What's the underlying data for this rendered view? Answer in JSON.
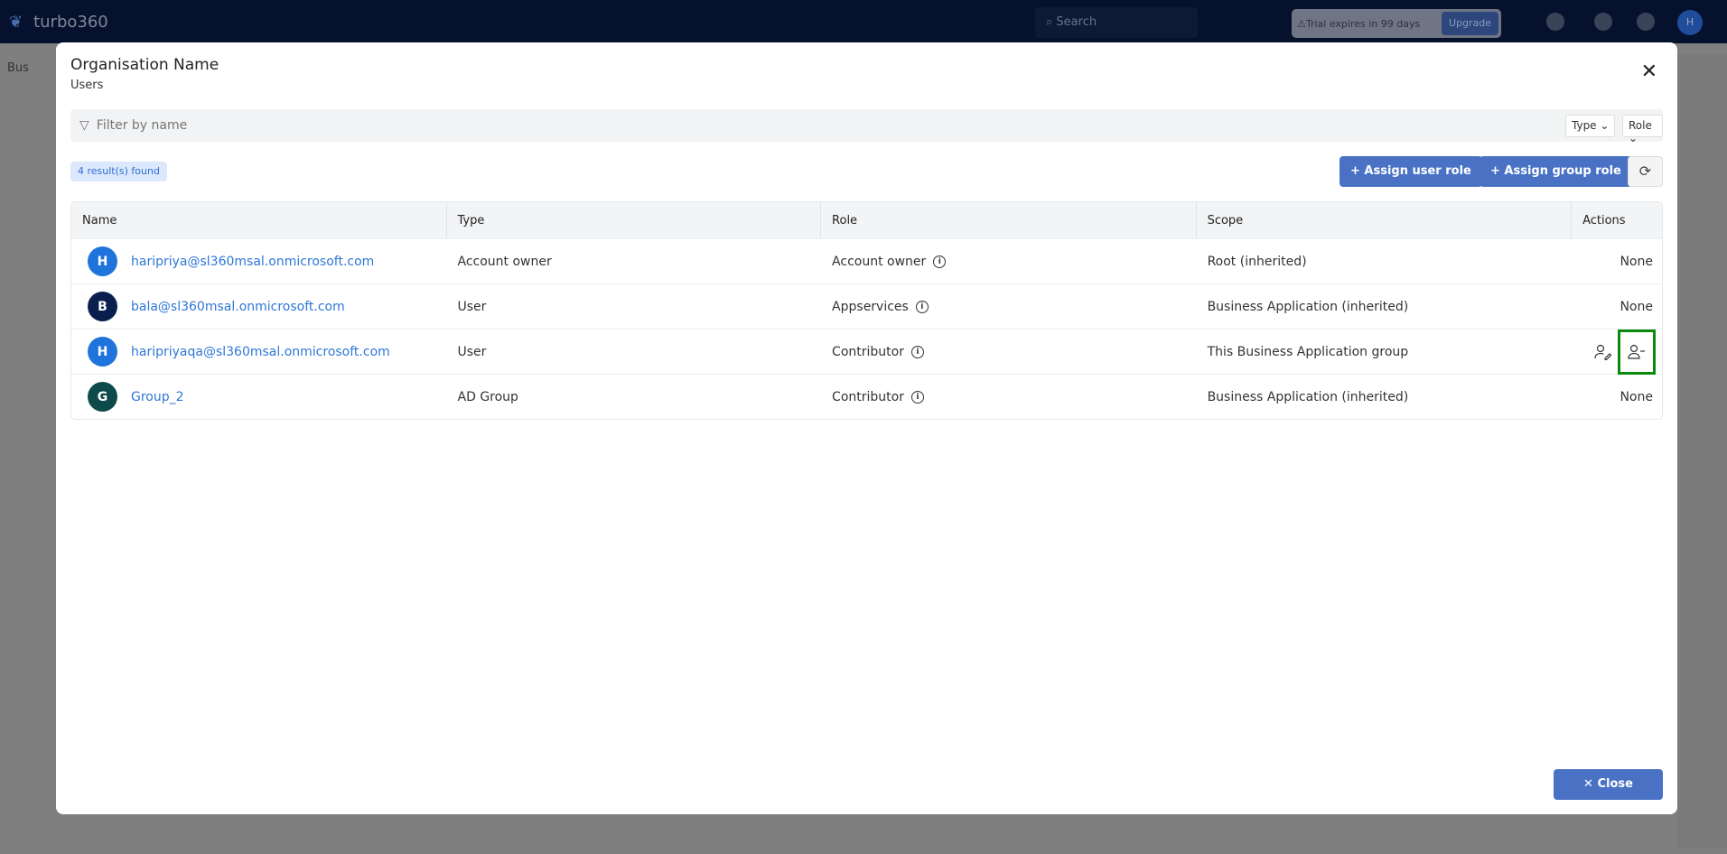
{
  "topbar": {
    "brand": "turbo360",
    "search_placeholder": "Search",
    "trial": "Trial expires in 99 days",
    "upgrade": "Upgrade",
    "avatar": "H"
  },
  "background": {
    "left_text": "Bus"
  },
  "modal": {
    "title": "Organisation Name",
    "subtitle": "Users",
    "filter_placeholder": "Filter by name",
    "type_dropdown": "Type",
    "role_dropdown": "Role",
    "results": "4 result(s) found",
    "assign_user_role": "+ Assign user role",
    "assign_group_role": "+ Assign group role",
    "columns": [
      "Name",
      "Type",
      "Role",
      "Scope",
      "Actions"
    ],
    "rows": [
      {
        "initial": "H",
        "color": "#1f74dc",
        "name": "haripriya@sl360msal.onmicrosoft.com",
        "type": "Account owner",
        "role": "Account owner",
        "scope": "Root (inherited)",
        "actions": "None"
      },
      {
        "initial": "B",
        "color": "#0b1f4f",
        "name": "bala@sl360msal.onmicrosoft.com",
        "type": "User",
        "role": "Appservices",
        "scope": "Business Application (inherited)",
        "actions": "None"
      },
      {
        "initial": "H",
        "color": "#1f74dc",
        "name": "haripriyaqa@sl360msal.onmicrosoft.com",
        "type": "User",
        "role": "Contributor",
        "scope": "This Business Application group",
        "actions": ""
      },
      {
        "initial": "G",
        "color": "#0f4a4a",
        "name": "Group_2",
        "type": "AD Group",
        "role": "Contributor",
        "scope": "Business Application (inherited)",
        "actions": "None"
      }
    ],
    "close": "✕ Close"
  }
}
